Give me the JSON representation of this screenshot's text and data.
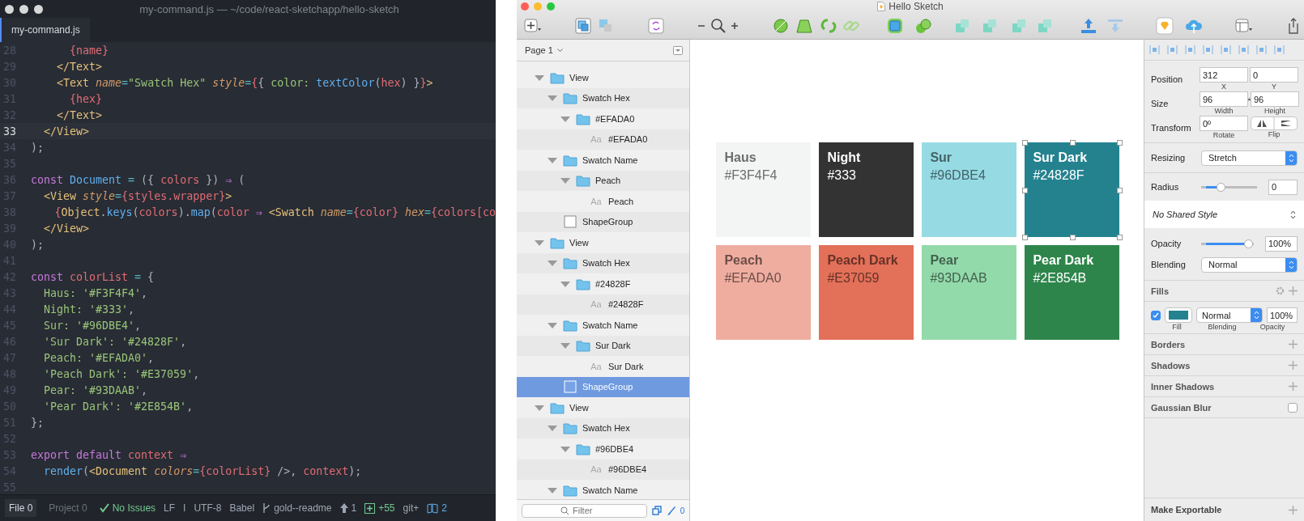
{
  "editor": {
    "title": "my-command.js — ~/code/react-sketchapp/hello-sketch",
    "tabs": [
      {
        "label": "my-command.js",
        "selected": true
      }
    ],
    "lines": [
      {
        "number": "28",
        "current": false,
        "tokens": [
          {
            "kind": "var",
            "text": "      {name}"
          }
        ]
      },
      {
        "number": "29",
        "current": false,
        "tokens": [
          {
            "kind": "tag",
            "text": "    </Text>"
          }
        ]
      },
      {
        "number": "30",
        "current": false,
        "tokens": [
          {
            "kind": "tag",
            "text": "    <Text"
          },
          {
            "kind": "attr",
            "text": " name"
          },
          {
            "kind": "op",
            "text": "="
          },
          {
            "kind": "str",
            "text": "\"Swatch Hex\""
          },
          {
            "kind": "attr",
            "text": " style"
          },
          {
            "kind": "op",
            "text": "="
          },
          {
            "kind": "var",
            "text": "{"
          },
          {
            "kind": "p",
            "text": "{ "
          },
          {
            "kind": "str",
            "text": "color:"
          },
          {
            "kind": "fn",
            "text": " textColor"
          },
          {
            "kind": "p",
            "text": "("
          },
          {
            "kind": "var",
            "text": "hex"
          },
          {
            "kind": "p",
            "text": ") }"
          },
          {
            "kind": "var",
            "text": "}"
          },
          {
            "kind": "tag",
            "text": ">"
          }
        ]
      },
      {
        "number": "31",
        "current": false,
        "tokens": [
          {
            "kind": "var",
            "text": "      {hex}"
          }
        ]
      },
      {
        "number": "32",
        "current": false,
        "tokens": [
          {
            "kind": "tag",
            "text": "    </Text>"
          }
        ]
      },
      {
        "number": "33",
        "current": true,
        "tokens": [
          {
            "kind": "tag",
            "text": "  </View>"
          }
        ]
      },
      {
        "number": "34",
        "current": false,
        "tokens": [
          {
            "kind": "p",
            "text": ");"
          }
        ]
      },
      {
        "number": "35",
        "current": false
      },
      {
        "number": "36",
        "current": false,
        "tokens": [
          {
            "kind": "kw",
            "text": "const"
          },
          {
            "kind": "fn",
            "text": " Document"
          },
          {
            "kind": "op",
            "text": " ="
          },
          {
            "kind": "p",
            "text": " ({ "
          },
          {
            "kind": "var",
            "text": "colors"
          },
          {
            "kind": "p",
            "text": " }) "
          },
          {
            "kind": "kw",
            "text": "⇒"
          },
          {
            "kind": "p",
            "text": " ("
          }
        ]
      },
      {
        "number": "37",
        "current": false,
        "tokens": [
          {
            "kind": "tag",
            "text": "  <View"
          },
          {
            "kind": "attr",
            "text": " style"
          },
          {
            "kind": "op",
            "text": "="
          },
          {
            "kind": "var",
            "text": "{styles.wrapper}"
          },
          {
            "kind": "tag",
            "text": ">"
          }
        ]
      },
      {
        "number": "38",
        "current": false,
        "tokens": [
          {
            "kind": "var",
            "text": "    {"
          },
          {
            "kind": "tag",
            "text": "Object"
          },
          {
            "kind": "p",
            "text": "."
          },
          {
            "kind": "fn",
            "text": "keys"
          },
          {
            "kind": "p",
            "text": "("
          },
          {
            "kind": "var",
            "text": "colors"
          },
          {
            "kind": "p",
            "text": ")."
          },
          {
            "kind": "fn",
            "text": "map"
          },
          {
            "kind": "p",
            "text": "("
          },
          {
            "kind": "var",
            "text": "color"
          },
          {
            "kind": "kw",
            "text": " ⇒"
          },
          {
            "kind": "tag",
            "text": " <Swatch"
          },
          {
            "kind": "attr",
            "text": " name"
          },
          {
            "kind": "op",
            "text": "="
          },
          {
            "kind": "var",
            "text": "{color}"
          },
          {
            "kind": "attr",
            "text": " hex"
          },
          {
            "kind": "op",
            "text": "="
          },
          {
            "kind": "var",
            "text": "{colors[co"
          }
        ]
      },
      {
        "number": "39",
        "current": false,
        "tokens": [
          {
            "kind": "tag",
            "text": "  </View>"
          }
        ]
      },
      {
        "number": "40",
        "current": false,
        "tokens": [
          {
            "kind": "p",
            "text": ");"
          }
        ]
      },
      {
        "number": "41",
        "current": false
      },
      {
        "number": "42",
        "current": false,
        "tokens": [
          {
            "kind": "kw",
            "text": "const"
          },
          {
            "kind": "var",
            "text": " colorList"
          },
          {
            "kind": "op",
            "text": " ="
          },
          {
            "kind": "p",
            "text": " {"
          }
        ]
      },
      {
        "number": "43",
        "current": false,
        "tokens": [
          {
            "kind": "str",
            "text": "  Haus: '#F3F4F4'"
          },
          {
            "kind": "p",
            "text": ","
          }
        ]
      },
      {
        "number": "44",
        "current": false,
        "tokens": [
          {
            "kind": "str",
            "text": "  Night: '#333'"
          },
          {
            "kind": "p",
            "text": ","
          }
        ]
      },
      {
        "number": "45",
        "current": false,
        "tokens": [
          {
            "kind": "str",
            "text": "  Sur: '#96DBE4'"
          },
          {
            "kind": "p",
            "text": ","
          }
        ]
      },
      {
        "number": "46",
        "current": false,
        "tokens": [
          {
            "kind": "str",
            "text": "  'Sur Dark': '#24828F'"
          },
          {
            "kind": "p",
            "text": ","
          }
        ]
      },
      {
        "number": "47",
        "current": false,
        "tokens": [
          {
            "kind": "str",
            "text": "  Peach: '#EFADA0'"
          },
          {
            "kind": "p",
            "text": ","
          }
        ]
      },
      {
        "number": "48",
        "current": false,
        "tokens": [
          {
            "kind": "str",
            "text": "  'Peach Dark': '#E37059'"
          },
          {
            "kind": "p",
            "text": ","
          }
        ]
      },
      {
        "number": "49",
        "current": false,
        "tokens": [
          {
            "kind": "str",
            "text": "  Pear: '#93DAAB'"
          },
          {
            "kind": "p",
            "text": ","
          }
        ]
      },
      {
        "number": "50",
        "current": false,
        "tokens": [
          {
            "kind": "str",
            "text": "  'Pear Dark': '#2E854B'"
          },
          {
            "kind": "p",
            "text": ","
          }
        ]
      },
      {
        "number": "51",
        "current": false,
        "tokens": [
          {
            "kind": "p",
            "text": "};"
          }
        ]
      },
      {
        "number": "52",
        "current": false
      },
      {
        "number": "53",
        "current": false,
        "tokens": [
          {
            "kind": "kw",
            "text": "export default"
          },
          {
            "kind": "var",
            "text": " context"
          },
          {
            "kind": "kw",
            "text": " ⇒"
          }
        ]
      },
      {
        "number": "54",
        "current": false,
        "tokens": [
          {
            "kind": "fn",
            "text": "  render"
          },
          {
            "kind": "p",
            "text": "("
          },
          {
            "kind": "tag",
            "text": "<Document"
          },
          {
            "kind": "attr",
            "text": " colors"
          },
          {
            "kind": "op",
            "text": "="
          },
          {
            "kind": "var",
            "text": "{colorList}"
          },
          {
            "kind": "p",
            "text": " />, "
          },
          {
            "kind": "var",
            "text": "context"
          },
          {
            "kind": "p",
            "text": ");"
          }
        ]
      },
      {
        "number": "55",
        "current": false
      }
    ],
    "status_bar": [
      {
        "kind": "tab",
        "text": "File 0",
        "selected": true
      },
      {
        "kind": "tab",
        "text": "Project 0",
        "selected": false
      },
      {
        "kind": "issues",
        "text": "No Issues"
      },
      {
        "kind": "text",
        "text": "LF"
      },
      {
        "kind": "text",
        "text": "I"
      },
      {
        "kind": "text",
        "text": "UTF-8"
      },
      {
        "kind": "text",
        "text": "Babel"
      },
      {
        "kind": "branch",
        "text": "gold--readme"
      },
      {
        "kind": "push",
        "text": "1"
      },
      {
        "kind": "diff",
        "text": "+55"
      },
      {
        "kind": "text",
        "text": "git+"
      },
      {
        "kind": "packages",
        "text": "2"
      }
    ]
  },
  "sketch": {
    "title": "Hello Sketch",
    "page": "Page 1",
    "layers": [
      {
        "name": "View",
        "kind": "group",
        "expanded": true,
        "selected": false,
        "children": [
          {
            "name": "Swatch Hex",
            "kind": "group",
            "expanded": true,
            "selected": false,
            "children": [
              {
                "name": "#EFADA0",
                "kind": "group",
                "expanded": true,
                "selected": false,
                "children": [
                  {
                    "name": "#EFADA0",
                    "kind": "text",
                    "glyph": "Aa",
                    "selected": false
                  }
                ]
              }
            ]
          },
          {
            "name": "Swatch Name",
            "kind": "group",
            "expanded": true,
            "selected": false,
            "children": [
              {
                "name": "Peach",
                "kind": "group",
                "expanded": true,
                "selected": false,
                "children": [
                  {
                    "name": "Peach",
                    "kind": "text",
                    "glyph": "Aa",
                    "selected": false
                  }
                ]
              }
            ]
          },
          {
            "name": "ShapeGroup",
            "kind": "shape",
            "selected": false
          }
        ]
      },
      {
        "name": "View",
        "kind": "group",
        "expanded": true,
        "selected": false,
        "children": [
          {
            "name": "Swatch Hex",
            "kind": "group",
            "expanded": true,
            "selected": false,
            "children": [
              {
                "name": "#24828F",
                "kind": "group",
                "expanded": true,
                "selected": false,
                "children": [
                  {
                    "name": "#24828F",
                    "kind": "text",
                    "glyph": "Aa",
                    "selected": false
                  }
                ]
              }
            ]
          },
          {
            "name": "Swatch Name",
            "kind": "group",
            "expanded": true,
            "selected": false,
            "children": [
              {
                "name": "Sur Dark",
                "kind": "group",
                "expanded": true,
                "selected": false,
                "children": [
                  {
                    "name": "Sur Dark",
                    "kind": "text",
                    "glyph": "Aa",
                    "selected": false
                  }
                ]
              }
            ]
          },
          {
            "name": "ShapeGroup",
            "kind": "shape",
            "selected": true
          }
        ]
      },
      {
        "name": "View",
        "kind": "group",
        "expanded": true,
        "selected": false,
        "children": [
          {
            "name": "Swatch Hex",
            "kind": "group",
            "expanded": true,
            "selected": false,
            "children": [
              {
                "name": "#96DBE4",
                "kind": "group",
                "expanded": true,
                "selected": false,
                "children": [
                  {
                    "name": "#96DBE4",
                    "kind": "text",
                    "glyph": "Aa",
                    "selected": false
                  }
                ]
              }
            ]
          },
          {
            "name": "Swatch Name",
            "kind": "group",
            "expanded": true,
            "selected": false
          }
        ]
      }
    ],
    "filter": {
      "placeholder": "Filter",
      "count": "0"
    },
    "swatches": [
      {
        "name": "Haus",
        "hex": "#F3F4F4",
        "color": "#f3f4f4",
        "selected": false
      },
      {
        "name": "Night",
        "hex": "#333",
        "color": "#333333",
        "selected": false
      },
      {
        "name": "Sur",
        "hex": "#96DBE4",
        "color": "#96dbe4",
        "selected": false
      },
      {
        "name": "Sur Dark",
        "hex": "#24828F",
        "color": "#24828f",
        "selected": true
      },
      {
        "name": "Peach",
        "hex": "#EFADA0",
        "color": "#efada0",
        "selected": false
      },
      {
        "name": "Peach Dark",
        "hex": "#E37059",
        "color": "#e37059",
        "selected": false
      },
      {
        "name": "Pear",
        "hex": "#93DAAB",
        "color": "#93daab",
        "selected": false
      },
      {
        "name": "Pear Dark",
        "hex": "#2E854B",
        "color": "#2e854b",
        "selected": false
      }
    ],
    "inspector": {
      "position": {
        "label": "Position",
        "fields": [
          {
            "value": "312",
            "caption": "X"
          },
          {
            "value": "0",
            "caption": "Y"
          }
        ]
      },
      "size": {
        "label": "Size",
        "fields": [
          {
            "value": "96",
            "caption": "Width"
          },
          {
            "value": "96",
            "caption": "Height"
          }
        ]
      },
      "transform": {
        "label": "Transform",
        "value": "0º",
        "caption": "Rotate",
        "flip_caption": "Flip"
      },
      "resizing": {
        "label": "Resizing",
        "value": "Stretch"
      },
      "radius": {
        "label": "Radius",
        "level": 0.32,
        "value": "0"
      },
      "shared_style": "No Shared Style",
      "opacity": {
        "label": "Opacity",
        "level": 1,
        "value": "100%"
      },
      "blending": {
        "label": "Blending",
        "value": "Normal"
      },
      "fills": {
        "title": "Fills",
        "items": [
          {
            "checked": true,
            "color": "#24828f",
            "blending": "Normal",
            "opacity": "100%"
          }
        ],
        "captions": [
          "Fill",
          "Blending",
          "Opacity"
        ]
      },
      "sections": [
        {
          "title": "Borders",
          "kind": "add"
        },
        {
          "title": "Shadows",
          "kind": "add"
        },
        {
          "title": "Inner Shadows",
          "kind": "add"
        },
        {
          "title": "Gaussian Blur",
          "kind": "toggle",
          "checked": false
        }
      ],
      "footer": "Make Exportable"
    }
  }
}
